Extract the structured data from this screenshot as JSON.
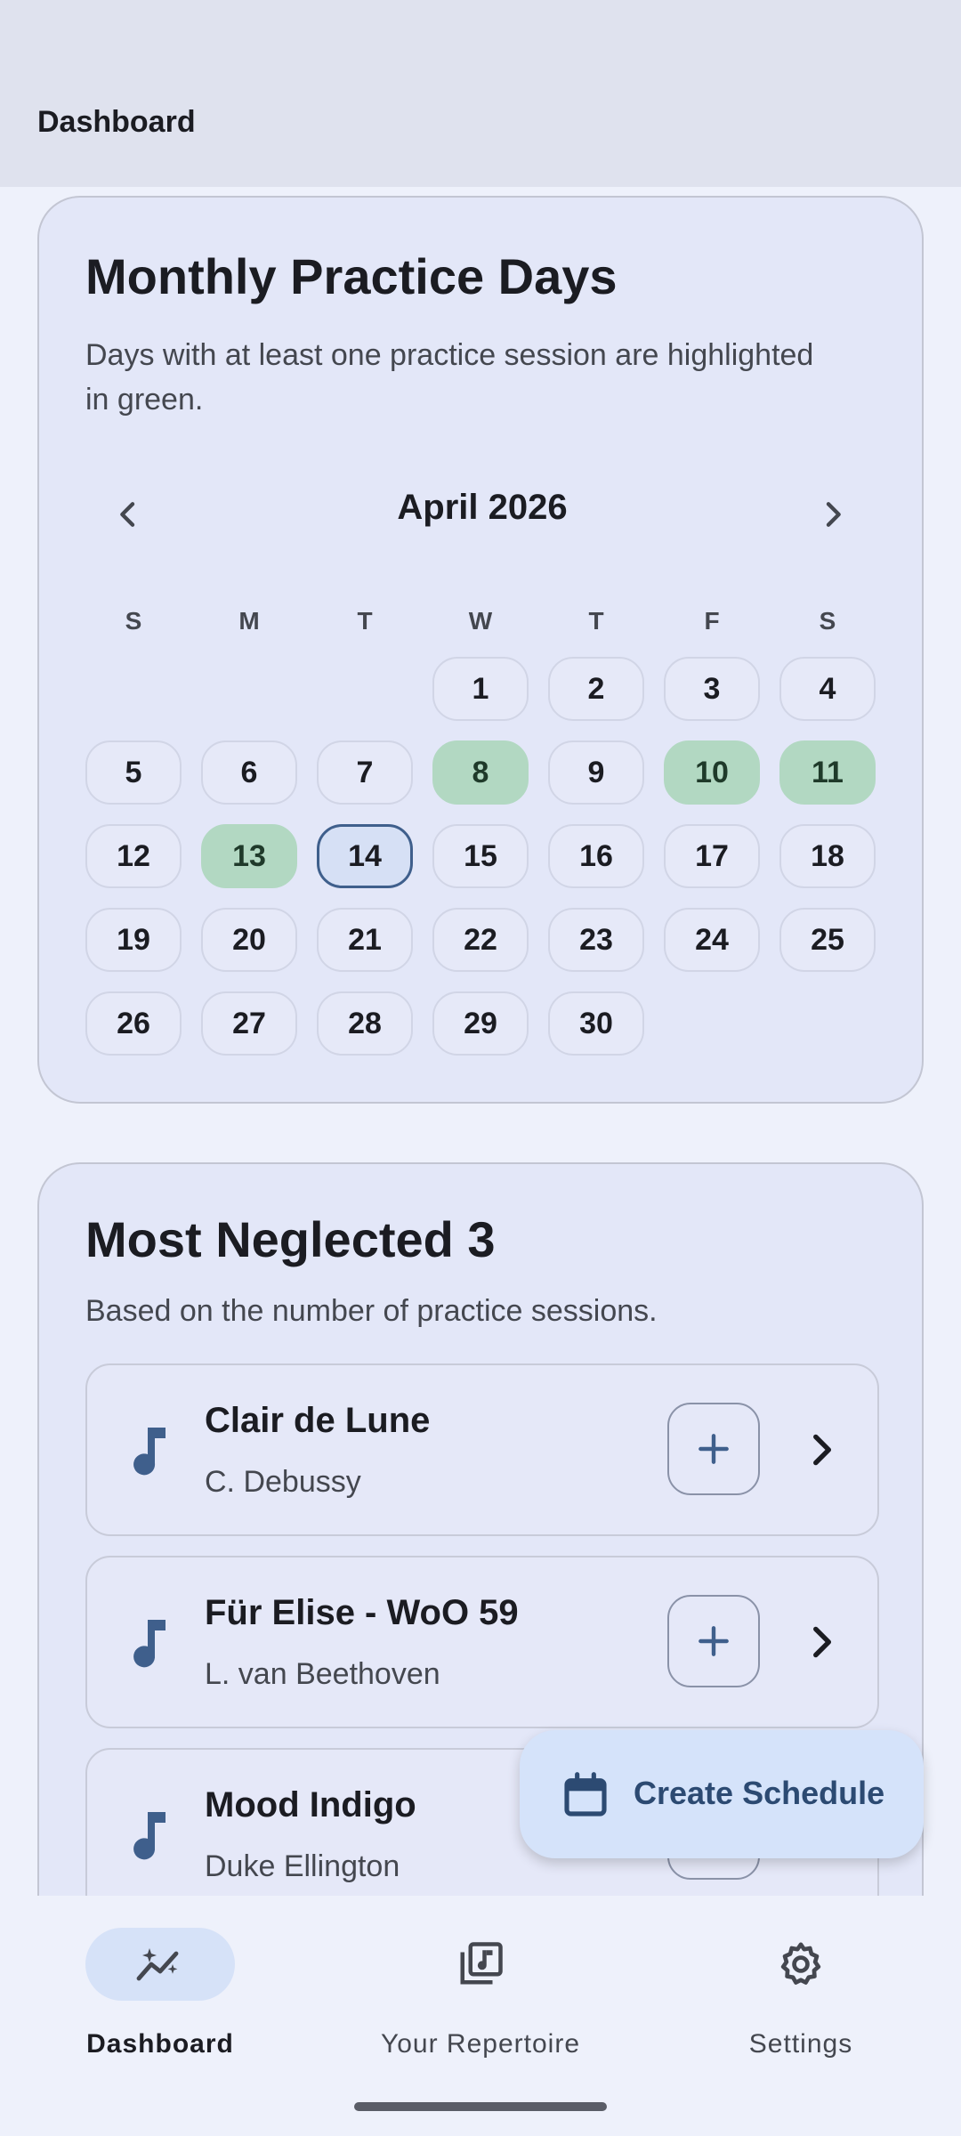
{
  "appbar": {
    "title": "Dashboard"
  },
  "calendar_card": {
    "title": "Monthly Practice Days",
    "subtitle": "Days with at least one practice session are highlighted in green.",
    "month_label": "April 2026",
    "weekdays": [
      "S",
      "M",
      "T",
      "W",
      "T",
      "F",
      "S"
    ],
    "first_weekday_index": 3,
    "days": [
      "1",
      "2",
      "3",
      "4",
      "5",
      "6",
      "7",
      "8",
      "9",
      "10",
      "11",
      "12",
      "13",
      "14",
      "15",
      "16",
      "17",
      "18",
      "19",
      "20",
      "21",
      "22",
      "23",
      "24",
      "25",
      "26",
      "27",
      "28",
      "29",
      "30"
    ],
    "practiced_days": [
      8,
      10,
      11,
      13
    ],
    "today": 14,
    "colors": {
      "practiced": "#b2d8c2",
      "today_border": "#3f5f8c"
    }
  },
  "neglected_card": {
    "title": "Most Neglected 3",
    "subtitle": "Based on the number of practice sessions.",
    "items": [
      {
        "title": "Clair de Lune",
        "composer": "C. Debussy"
      },
      {
        "title": "Für Elise - WoO 59",
        "composer": "L. van Beethoven"
      },
      {
        "title": "Mood Indigo",
        "composer": "Duke Ellington"
      }
    ]
  },
  "fab": {
    "label": "Create Schedule",
    "icon": "calendar-icon"
  },
  "bottom_nav": {
    "items": [
      {
        "label": "Dashboard",
        "icon": "insights-icon",
        "active": true
      },
      {
        "label": "Your Repertoire",
        "icon": "library-music-icon",
        "active": false
      },
      {
        "label": "Settings",
        "icon": "gear-icon",
        "active": false
      }
    ]
  }
}
